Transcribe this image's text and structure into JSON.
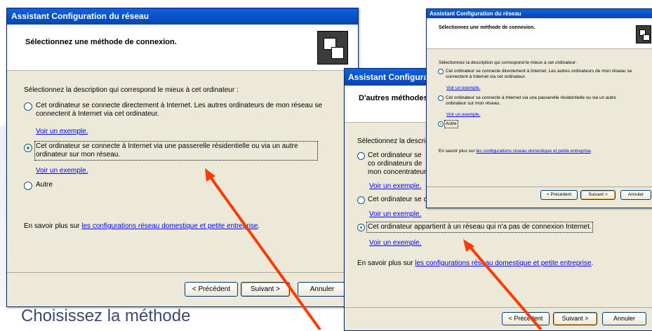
{
  "caption": "Choisissez la méthode",
  "dialog1": {
    "title": "Assistant Configuration du réseau",
    "header": "Sélectionnez une méthode de connexion.",
    "prompt": "Sélectionnez la description qui correspond le mieux à cet ordinateur :",
    "options": [
      {
        "label": "Cet ordinateur se connecte directement à Internet. Les autres ordinateurs de mon réseau se connectent à Internet via cet ordinateur.",
        "link": "Voir un exemple.",
        "selected": false
      },
      {
        "label": "Cet ordinateur se connecte à Internet via une passerelle résidentielle ou via un autre ordinateur sur mon réseau.",
        "link": "Voir un exemple.",
        "selected": true
      },
      {
        "label": "Autre",
        "selected": false
      }
    ],
    "learn_prefix": "En savoir plus sur ",
    "learn_link": "les configurations réseau domestique et petite entreprise",
    "learn_suffix": ".",
    "buttons": {
      "back": "< Précédent",
      "next": "Suivant >",
      "cancel": "Annuler"
    }
  },
  "dialog2": {
    "title": "Assistant Configurati",
    "header": "D'autres méthodes",
    "prompt": "Sélectionnez la descrip",
    "option1_label": "Cet ordinateur se co ordinateurs de mon concentrateur.",
    "option1_link": "Voir un exemple.",
    "option2_label": "Cet ordinateur se co",
    "option2_link": "Voir un exemple.",
    "option3_label": "Cet ordinateur appartient à un réseau qui n'a pas de connexion Internet.",
    "option3_link": "Voir un exemple.",
    "learn_prefix": "En savoir plus sur ",
    "learn_link": "les configurations réseau domestique et petite entreprise",
    "learn_suffix": ".",
    "buttons": {
      "back": "< Précédent",
      "next": "Suivant >",
      "cancel": "Annuler"
    }
  },
  "dialog3": {
    "title": "Assistant Configuration du réseau",
    "header": "Sélectionnez une méthode de connexion.",
    "prompt": "Sélectionnez la description qui correspond le mieux à cet ordinateur :",
    "options": [
      {
        "label": "Cet ordinateur se connecte directement à Internet. Les autres ordinateurs de mon réseau se connectent à Internet via cet ordinateur.",
        "link": "Voir un exemple.",
        "selected": false
      },
      {
        "label": "Cet ordinateur se connecte à Internet via une passerelle résidentielle ou via un autre ordinateur sur mon réseau.",
        "link": "Voir un exemple.",
        "selected": false
      },
      {
        "label": "Autre",
        "selected": true
      }
    ],
    "learn_prefix": "En savoir plus sur ",
    "learn_link": "les configurations réseau domestique et petite entreprise",
    "learn_suffix": ".",
    "buttons": {
      "back": "< Précédent",
      "next": "Suivant >",
      "cancel": "Annuler"
    }
  },
  "colors": {
    "arrow": "#ff3b00",
    "title_bar": "#0a4fc4",
    "link": "#0000ee"
  }
}
